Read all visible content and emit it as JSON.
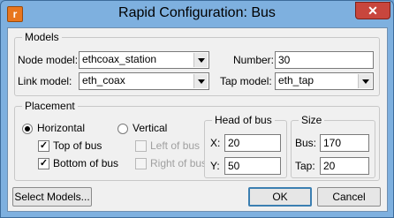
{
  "window": {
    "title": "Rapid Configuration: Bus",
    "app_icon_letter": "r",
    "close_glyph": "✕"
  },
  "models": {
    "legend": "Models",
    "node_model_label": "Node model:",
    "node_model_value": "ethcoax_station",
    "link_model_label": "Link model:",
    "link_model_value": "eth_coax",
    "number_label": "Number:",
    "number_value": "30",
    "tap_model_label": "Tap model:",
    "tap_model_value": "eth_tap"
  },
  "placement": {
    "legend": "Placement",
    "horizontal": {
      "label": "Horizontal",
      "selected": true
    },
    "vertical": {
      "label": "Vertical",
      "selected": false
    },
    "top_of_bus": {
      "label": "Top of bus",
      "checked": true
    },
    "bottom_of_bus": {
      "label": "Bottom of bus",
      "checked": true
    },
    "left_of_bus": {
      "label": "Left of bus",
      "checked": false,
      "disabled": true
    },
    "right_of_bus": {
      "label": "Right of bus",
      "checked": false,
      "disabled": true
    }
  },
  "head_of_bus": {
    "legend": "Head of bus",
    "x_label": "X:",
    "x_value": "20",
    "y_label": "Y:",
    "y_value": "50"
  },
  "size": {
    "legend": "Size",
    "bus_label": "Bus:",
    "bus_value": "170",
    "tap_label": "Tap:",
    "tap_value": "20"
  },
  "buttons": {
    "select_models": "Select Models...",
    "ok": "OK",
    "cancel": "Cancel"
  },
  "colors": {
    "frame": "#7eb0df",
    "close": "#c8463d",
    "client": "#f0f0f0"
  }
}
